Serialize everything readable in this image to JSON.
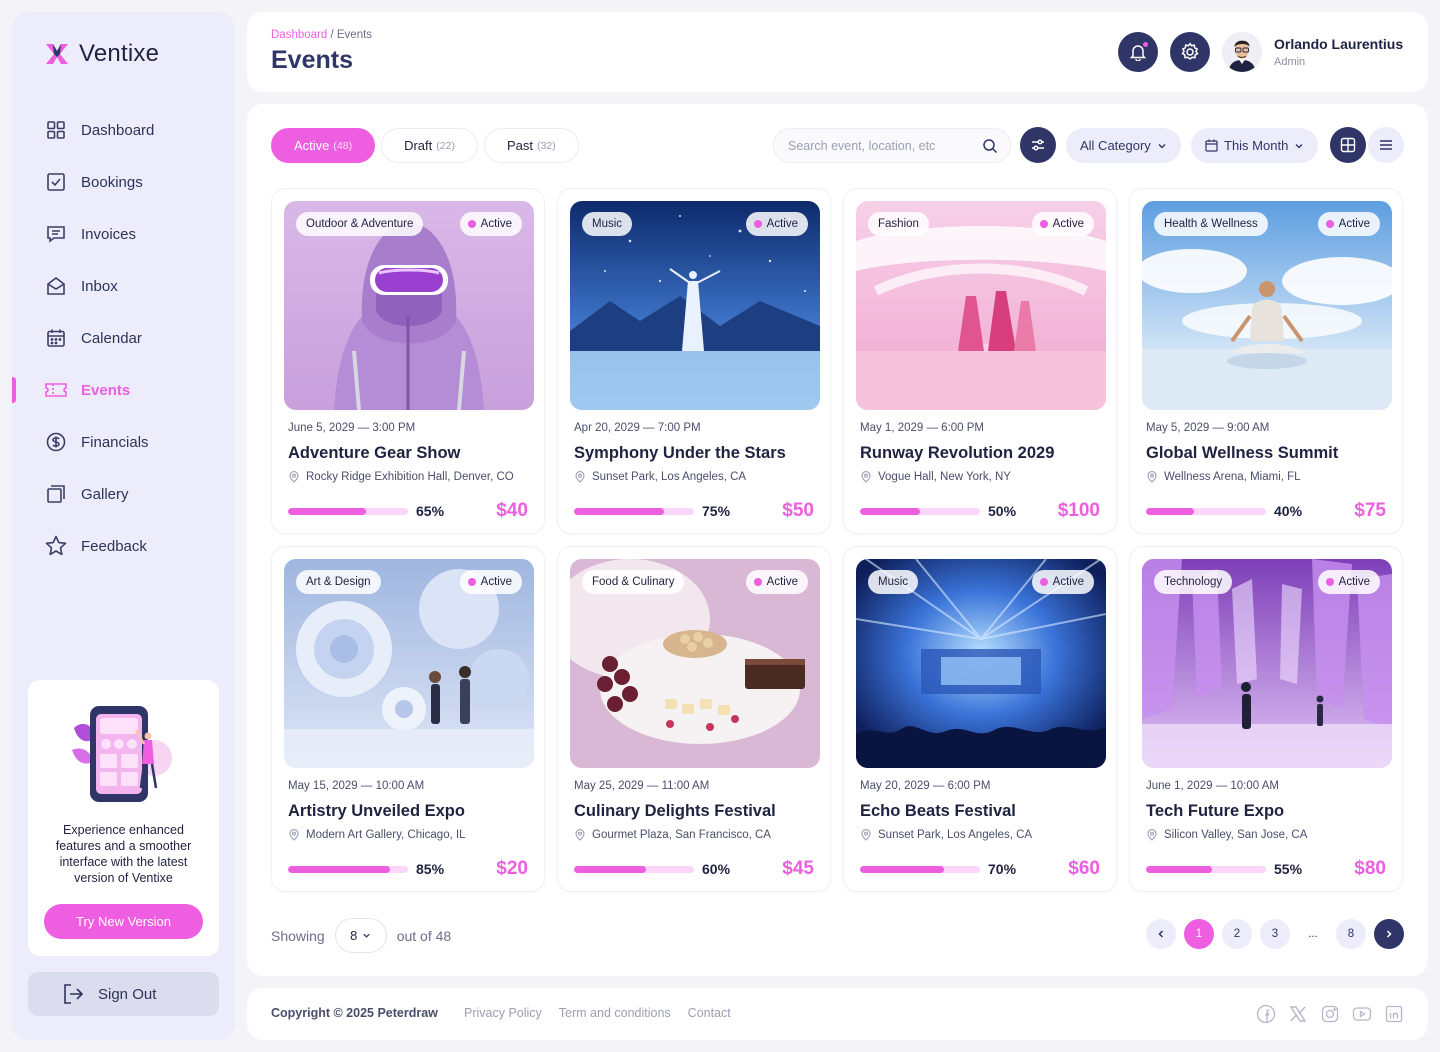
{
  "app": {
    "name": "Ventixe",
    "brand_color": "#ee5ee0",
    "navy": "#2f3566"
  },
  "sidebar": {
    "items": [
      {
        "label": "Dashboard",
        "icon": "dashboard-icon"
      },
      {
        "label": "Bookings",
        "icon": "bookings-icon"
      },
      {
        "label": "Invoices",
        "icon": "invoices-icon"
      },
      {
        "label": "Inbox",
        "icon": "inbox-icon"
      },
      {
        "label": "Calendar",
        "icon": "calendar-icon"
      },
      {
        "label": "Events",
        "icon": "ticket-icon",
        "active": true
      },
      {
        "label": "Financials",
        "icon": "dollar-icon"
      },
      {
        "label": "Gallery",
        "icon": "gallery-icon"
      },
      {
        "label": "Feedback",
        "icon": "star-icon"
      }
    ],
    "promo_text": "Experience enhanced features and a smoother interface with the latest version of Ventixe",
    "promo_button": "Try New Version",
    "signout_label": "Sign Out"
  },
  "header": {
    "breadcrumb_root": "Dashboard",
    "breadcrumb_sep": "/",
    "breadcrumb_current": "Events",
    "title": "Events",
    "user_name": "Orlando Laurentius",
    "user_role": "Admin"
  },
  "toolbar": {
    "tabs": [
      {
        "label": "Active",
        "count": "(48)",
        "active": true
      },
      {
        "label": "Draft",
        "count": "(22)"
      },
      {
        "label": "Past",
        "count": "(32)"
      }
    ],
    "search_placeholder": "Search event, location, etc",
    "category_label": "All Category",
    "period_label": "This Month"
  },
  "events": [
    {
      "category": "Outdoor & Adventure",
      "status": "Active",
      "date": "June 5, 2029 — 3:00 PM",
      "title": "Adventure Gear Show",
      "location": "Rocky Ridge Exhibition Hall, Denver, CO",
      "progress": 65,
      "progress_label": "65%",
      "price": "$40",
      "theme": "purple-hood"
    },
    {
      "category": "Music",
      "status": "Active",
      "date": "Apr 20, 2029 — 7:00 PM",
      "title": "Symphony Under the Stars",
      "location": "Sunset Park, Los Angeles, CA",
      "progress": 75,
      "progress_label": "75%",
      "price": "$50",
      "theme": "starry-blue"
    },
    {
      "category": "Fashion",
      "status": "Active",
      "date": "May 1, 2029 — 6:00 PM",
      "title": "Runway Revolution 2029",
      "location": "Vogue Hall, New York, NY",
      "progress": 50,
      "progress_label": "50%",
      "price": "$100",
      "theme": "pink-hall"
    },
    {
      "category": "Health & Wellness",
      "status": "Active",
      "date": "May 5, 2029 — 9:00 AM",
      "title": "Global Wellness Summit",
      "location": "Wellness Arena, Miami, FL",
      "progress": 40,
      "progress_label": "40%",
      "price": "$75",
      "theme": "sky-yoga"
    },
    {
      "category": "Art & Design",
      "status": "Active",
      "date": "May 15, 2029 — 10:00 AM",
      "title": "Artistry Unveiled Expo",
      "location": "Modern Art Gallery, Chicago, IL",
      "progress": 85,
      "progress_label": "85%",
      "price": "$20",
      "theme": "art-bubbles"
    },
    {
      "category": "Food & Culinary",
      "status": "Active",
      "date": "May 25, 2029 — 11:00 AM",
      "title": "Culinary Delights Festival",
      "location": "Gourmet Plaza, San Francisco, CA",
      "progress": 60,
      "progress_label": "60%",
      "price": "$45",
      "theme": "food"
    },
    {
      "category": "Music",
      "status": "Active",
      "date": "May 20, 2029 — 6:00 PM",
      "title": "Echo Beats Festival",
      "location": "Sunset Park, Los Angeles, CA",
      "progress": 70,
      "progress_label": "70%",
      "price": "$60",
      "theme": "concert"
    },
    {
      "category": "Technology",
      "status": "Active",
      "date": "June 1, 2029 — 10:00 AM",
      "title": "Tech Future Expo",
      "location": "Silicon Valley, San Jose, CA",
      "progress": 55,
      "progress_label": "55%",
      "price": "$80",
      "theme": "crystal"
    }
  ],
  "pagination": {
    "showing_label": "Showing",
    "per_page": "8",
    "out_of_label": "out of 48",
    "pages": [
      "1",
      "2",
      "3",
      "...",
      "8"
    ],
    "current": "1"
  },
  "footer": {
    "copyright": "Copyright © 2025 Peterdraw",
    "links": [
      "Privacy Policy",
      "Term and conditions",
      "Contact"
    ],
    "socials": [
      "facebook-icon",
      "x-icon",
      "instagram-icon",
      "youtube-icon",
      "linkedin-icon"
    ]
  }
}
